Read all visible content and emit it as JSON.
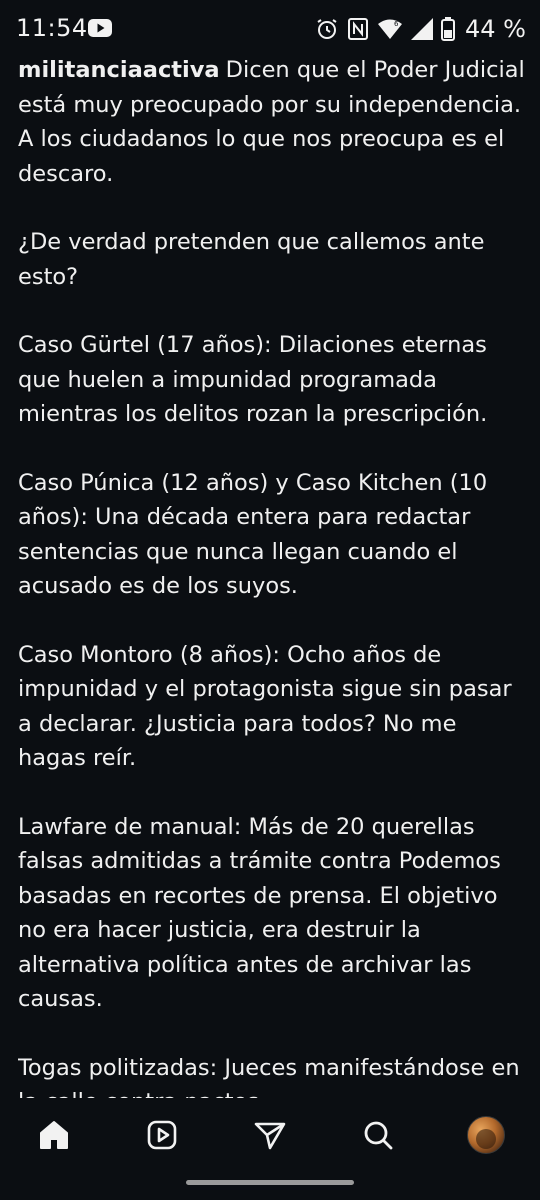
{
  "status_bar": {
    "time": "11:54",
    "battery": "44 %",
    "icons": [
      "youtube-icon",
      "alarm-icon",
      "nfc-icon",
      "wifi-icon",
      "signal-icon",
      "battery-icon"
    ]
  },
  "caption": {
    "username": "militanciaactiva",
    "paragraphs": [
      "Dicen que el Poder Judicial está muy preocupado por su independencia. A los ciudadanos lo que nos preocupa es el descaro.",
      "¿De verdad pretenden que callemos ante esto?",
      "Caso Gürtel (17 años): Dilaciones eternas que huelen a impunidad programada mientras los delitos rozan la prescripción.",
      "Caso Púnica (12 años) y Caso Kitchen (10 años): Una década entera para redactar sentencias que nunca llegan cuando el acusado es de los suyos.",
      "Caso Montoro (8 años): Ocho años de impunidad y el protagonista sigue sin pasar a declarar. ¿Justicia para todos? No me hagas reír.",
      "Lawfare de manual: Más de 20 querellas falsas admitidas a trámite contra Podemos basadas en recortes de prensa. El objetivo no era hacer justicia, era destruir la alternativa política antes de archivar las causas.",
      "Togas politizadas: Jueces manifestándose en la calle contra pactos"
    ]
  },
  "bottom_nav": {
    "items": [
      "home-icon",
      "reels-icon",
      "send-icon",
      "search-icon",
      "profile-avatar"
    ]
  },
  "colors": {
    "background": "#0b0e12",
    "text": "#f0f0f0"
  }
}
